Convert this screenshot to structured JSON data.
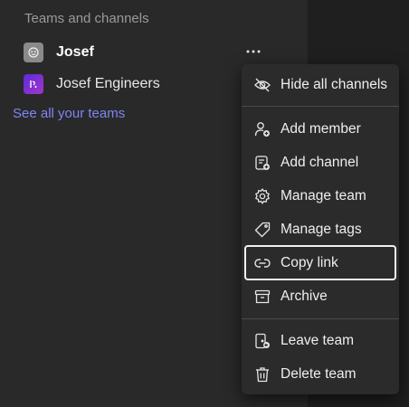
{
  "sidebar": {
    "section_title": "Teams and channels",
    "teams": [
      {
        "name": "Josef",
        "avatar_icon": "team-avatar-icon"
      },
      {
        "name": "Josef Engineers",
        "avatar_icon": "team-avatar-icon"
      }
    ],
    "more_options_icon": "ellipsis-icon",
    "see_all_link": "See all your teams"
  },
  "context_menu": {
    "items": [
      {
        "label": "Hide all channels",
        "icon": "eye-off-icon"
      },
      {
        "label": "Add member",
        "icon": "person-add-icon"
      },
      {
        "label": "Add channel",
        "icon": "channel-add-icon"
      },
      {
        "label": "Manage team",
        "icon": "gear-icon"
      },
      {
        "label": "Manage tags",
        "icon": "tag-icon"
      },
      {
        "label": "Copy link",
        "icon": "link-icon"
      },
      {
        "label": "Archive",
        "icon": "archive-icon"
      },
      {
        "label": "Leave team",
        "icon": "leave-icon"
      },
      {
        "label": "Delete team",
        "icon": "trash-icon"
      }
    ],
    "focused_item": "Copy link"
  },
  "colors": {
    "sidebar_bg": "#292929",
    "link": "#7f85f5",
    "menu_bg": "#2b2b2b",
    "focus_ring": "#f2f2f2"
  }
}
